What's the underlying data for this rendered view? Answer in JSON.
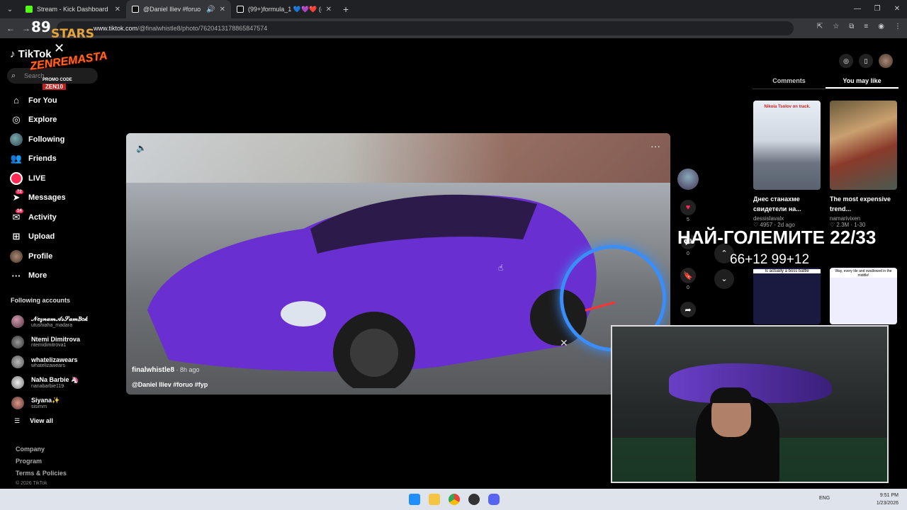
{
  "browser": {
    "tabs": [
      {
        "title": "Stream - Kick Dashboard",
        "favicon_color": "#53fc18"
      },
      {
        "title": "@Daniel Iliev #foruo #fyp | ",
        "favicon_color": "#ffffff"
      },
      {
        "title": "(99+)formula_1 💙💜❤️ (@re",
        "favicon_color": "#ffffff"
      }
    ],
    "url_host": "www.tiktok.com",
    "url_path": "/@finalwhistle8/photo/7620413178865847574"
  },
  "overlay": {
    "logo_89": "89",
    "logo_stars": "STARS",
    "logo_zen": "ZENREMASTA",
    "promo_label": "PROMO CODE",
    "promo_code": "ZEN10",
    "title": "НАЙ-ГОЛЕМИТЕ 22/33",
    "score": "66+12 99+12"
  },
  "sidebar": {
    "brand": "TikTok",
    "search_placeholder": "Search",
    "nav": [
      {
        "label": "For You",
        "icon": "home-icon"
      },
      {
        "label": "Explore",
        "icon": "compass-icon"
      },
      {
        "label": "Following",
        "icon": "following-avatar-icon"
      },
      {
        "label": "Friends",
        "icon": "friends-icon"
      },
      {
        "label": "LIVE",
        "icon": "live-icon"
      },
      {
        "label": "Messages",
        "icon": "messages-icon",
        "badge": "72"
      },
      {
        "label": "Activity",
        "icon": "activity-icon",
        "badge": "14"
      },
      {
        "label": "Upload",
        "icon": "upload-icon"
      },
      {
        "label": "Profile",
        "icon": "profile-avatar-icon"
      },
      {
        "label": "More",
        "icon": "more-icon"
      }
    ],
    "following_title": "Following accounts",
    "accounts": [
      {
        "name": "𝒩𝑒𝓏𝓃𝒶𝓂𝒜𝓈𝒮𝒶𝓂𝐵𝑜𝓀",
        "handle": "utushiaha_madara"
      },
      {
        "name": "Ntemi Dimitrova",
        "handle": "ntemidimitrova1"
      },
      {
        "name": "whatelizawears",
        "handle": "whatelizawears"
      },
      {
        "name": "NaNa Barbie 🦄",
        "handle": "nanabarbie119"
      },
      {
        "name": "Siyana✨",
        "handle": "sisimrn"
      }
    ],
    "view_all": "View all",
    "footer": [
      "Company",
      "Program",
      "Terms & Policies"
    ],
    "copyright": "© 2026 TikTok"
  },
  "video": {
    "author": "finalwhistle8",
    "time": " · 8h ago",
    "caption": "@Daniel Iliev #foruo #fyp",
    "car_color": "#6a2fd0",
    "likes": "5",
    "comments": "0",
    "saves": "0"
  },
  "right_panel": {
    "tabs": [
      "Comments",
      "You may like"
    ],
    "cards": [
      {
        "title": "Днес станахме свидетели на...",
        "author": "dessislavalx",
        "stats": "♡ 4957 · 2d ago",
        "thumb_text": "Nikola Tsolov on track."
      },
      {
        "title": "The most expensive trend...",
        "author": "namarivixen",
        "stats": "♡ 2.3M · 1-30",
        "thumb_text": ""
      }
    ],
    "small_thumbs": [
      "Is actually a boss battle",
      "Way, every tile and swallowed in the middle!"
    ]
  },
  "taskbar": {
    "lang": "ENG",
    "time": "9:51 PM",
    "date": "1/23/2026"
  }
}
